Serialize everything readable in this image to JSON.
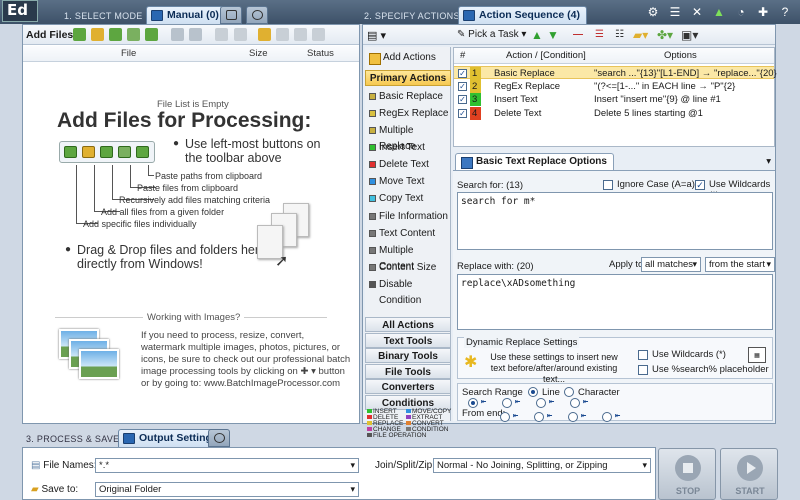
{
  "app": {
    "logo": "Ed"
  },
  "steps": {
    "select_mode": "1. SELECT MODE",
    "specify_actions": "2. SPECIFY ACTIONS",
    "process_save": "3. PROCESS & SAVE"
  },
  "tabs": {
    "manual": "Manual (0)",
    "action_sequence": "Action Sequence (4)",
    "output_settings": "Output Settings"
  },
  "left": {
    "add_files_label": "Add Files:",
    "columns": [
      "File",
      "Size",
      "Status"
    ],
    "empty_text": "File List is Empty",
    "title": "Add Files for Processing:",
    "bullet1": "Use left-most buttons on the toolbar above",
    "tree": [
      "Paste paths from clipboard",
      "Paste files from clipboard",
      "Recursively add files matching criteria",
      "Add all files from a given folder",
      "Add specific files individually"
    ],
    "bullet2": "Drag & Drop files and folders here directly from Windows!",
    "images_heading": "Working with Images?",
    "images_text": "If you need to process, resize, convert, watermark multiple images, photos, pictures, or icons, be sure to check out our professional batch image processing tools by clicking on",
    "images_text2": "button or by going to: www.BatchImageProcessor.com"
  },
  "right": {
    "pick_task": "Pick a Task",
    "add_actions": "Add Actions",
    "primary_actions": "Primary Actions",
    "primary": [
      {
        "label": "Basic Replace",
        "color": "#c8b040"
      },
      {
        "label": "RegEx Replace",
        "color": "#d8c040"
      },
      {
        "label": "Multiple Replace",
        "color": "#c8b040"
      },
      {
        "label": "Insert Text",
        "color": "#30c030"
      },
      {
        "label": "Delete Text",
        "color": "#e03030"
      },
      {
        "label": "Move Text",
        "color": "#3090e0"
      },
      {
        "label": "Copy Text",
        "color": "#40c0e0"
      }
    ],
    "secondary": [
      {
        "label": "File Information",
        "color": "#777777"
      },
      {
        "label": "Text Content",
        "color": "#777777"
      },
      {
        "label": "Multiple Content",
        "color": "#777777"
      },
      {
        "label": "Content Size",
        "color": "#777777"
      },
      {
        "label": "Disable Condition",
        "color": "#555555"
      }
    ],
    "categories": [
      "All Actions",
      "Text Tools",
      "Binary Tools",
      "File Tools",
      "Converters",
      "Conditions"
    ],
    "legend": [
      {
        "label": "INSERT",
        "color": "#30c030"
      },
      {
        "label": "MOVE/COPY",
        "color": "#3090e0"
      },
      {
        "label": "DELETE",
        "color": "#e03030"
      },
      {
        "label": "EXTRACT",
        "color": "#9040c0"
      },
      {
        "label": "REPLACE",
        "color": "#e0c030"
      },
      {
        "label": "CONVERT",
        "color": "#e08030"
      },
      {
        "label": "CHANGE",
        "color": "#c040a0"
      },
      {
        "label": "CONDITION",
        "color": "#777777"
      },
      {
        "label": "FILE OPERATION",
        "color": "#555555"
      }
    ],
    "seq_columns": [
      "#",
      "Action / [Condition]",
      "Options"
    ],
    "sequence": [
      {
        "num": "1",
        "color": "#e0c030",
        "name": "Basic Replace",
        "options": "\"search ...\"{13}\"[L1-END] → \"replace...\"{20}"
      },
      {
        "num": "2",
        "color": "#e0c030",
        "name": "RegEx Replace",
        "options": "\"(?<=[1-...\" in EACH line → \"P\"{2}"
      },
      {
        "num": "3",
        "color": "#30c030",
        "name": "Insert Text",
        "options": "Insert \"insert me\"{9} @ line #1"
      },
      {
        "num": "4",
        "color": "#e04020",
        "name": "Delete Text",
        "options": "Delete 5 lines starting @1"
      }
    ],
    "options_tab": "Basic Text Replace Options",
    "search_for_label": "Search for: (13)",
    "ignore_case": "Ignore Case (A=a)",
    "use_wildcards": "Use Wildcards (*)",
    "search_value": "search for m*",
    "replace_with_label": "Replace with: (20)",
    "apply_to_label": "Apply to:",
    "apply_to_value": "all matches",
    "from_value": "from the start",
    "replace_value": "replace\\xADsomething",
    "dynamic_title": "Dynamic Replace Settings",
    "dynamic_text": "Use these settings to insert new text before/after/around existing text...",
    "dyn_wildcards": "Use Wildcards (*)",
    "dyn_placeholder": "Use %search% placeholder",
    "search_range": "Search Range",
    "line": "Line",
    "character": "Character",
    "from_end": "From end:"
  },
  "bottom": {
    "file_names_label": "File Names:",
    "file_names_value": "*.*",
    "save_to_label": "Save to:",
    "save_to_value": "Original Folder",
    "join_label": "Join/Split/Zip:",
    "join_value": "Normal - No Joining, Splitting, or Zipping",
    "stop": "STOP",
    "start": "START"
  }
}
